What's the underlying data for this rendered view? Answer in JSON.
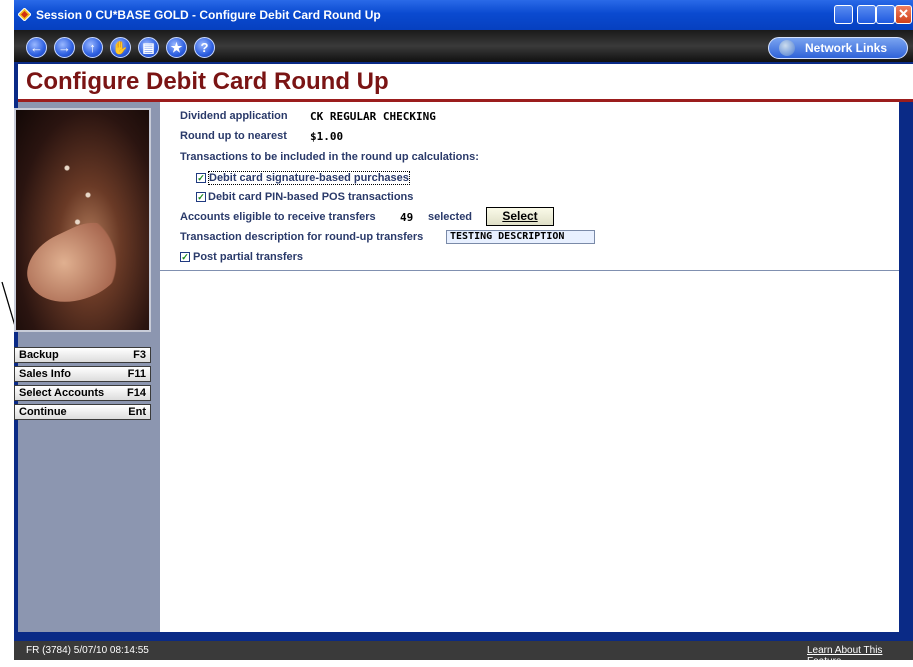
{
  "window": {
    "title": "Session 0 CU*BASE GOLD - Configure Debit Card Round Up"
  },
  "toolbar": {
    "nav_icons": [
      "back-icon",
      "forward-icon",
      "up-icon",
      "hand-icon",
      "print-icon",
      "star-icon",
      "help-icon"
    ],
    "network_links_label": "Network Links"
  },
  "page": {
    "title": "Configure Debit Card Round Up"
  },
  "form": {
    "dividend_application_label": "Dividend application",
    "dividend_application_value": "CK  REGULAR CHECKING",
    "round_up_label": "Round up to nearest",
    "round_up_value": "$1.00",
    "transactions_label": "Transactions to be included in the round up calculations:",
    "signature_label": "Debit card signature-based purchases",
    "signature_checked": true,
    "pin_label": "Debit card PIN-based POS transactions",
    "pin_checked": true,
    "accounts_label": "Accounts eligible to receive transfers",
    "accounts_count": "49",
    "accounts_selected_label": "selected",
    "select_button": "Select",
    "description_label": "Transaction description for round-up transfers",
    "description_value": "TESTING DESCRIPTION",
    "partial_label": "Post partial transfers",
    "partial_checked": true
  },
  "fkeys": [
    {
      "label": "Backup",
      "key": "F3"
    },
    {
      "label": "Sales Info",
      "key": "F11"
    },
    {
      "label": "Select Accounts",
      "key": "F14"
    },
    {
      "label": "Continue",
      "key": "Ent"
    }
  ],
  "status": {
    "left": "FR (3784) 5/07/10 08:14:55",
    "right": "Learn About This Feature"
  },
  "colors": {
    "title_red": "#7a1414",
    "label_blue": "#2a3a6a",
    "sidebar": "#8c96b0",
    "window_blue": "#0a2a86"
  }
}
